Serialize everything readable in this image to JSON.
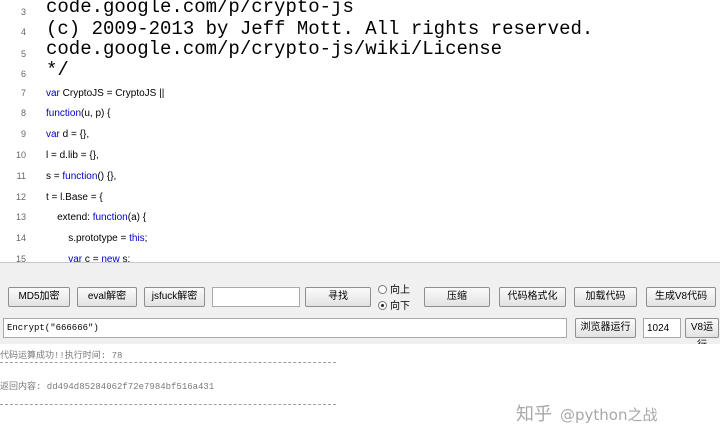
{
  "editor": {
    "lines": [
      {
        "num": "3",
        "text": "code.google.com/p/crypto-js",
        "size": "big",
        "kw": ""
      },
      {
        "num": "4",
        "text": "(c) 2009-2013 by Jeff Mott. All rights reserved.",
        "size": "big",
        "kw": ""
      },
      {
        "num": "5",
        "text": "code.google.com/p/crypto-js/wiki/License",
        "size": "big",
        "kw": ""
      },
      {
        "num": "6",
        "text": "*/",
        "size": "big",
        "kw": ""
      },
      {
        "num": "7",
        "text": " CryptoJS = CryptoJS ||",
        "size": "small",
        "kw": "var"
      },
      {
        "num": "8",
        "text": "(u, p) {",
        "size": "small",
        "kw": "function"
      },
      {
        "num": "9",
        "text": " d = {},",
        "size": "small",
        "kw": "var"
      },
      {
        "num": "10",
        "text": "l = d.lib = {},",
        "size": "small",
        "kw": ""
      },
      {
        "num": "11",
        "text": "s = function() {},",
        "size": "small",
        "kw": ""
      },
      {
        "num": "12",
        "text": "t = l.Base = {",
        "size": "small",
        "kw": ""
      },
      {
        "num": "13",
        "text": "    extend: function(a) {",
        "size": "small",
        "kw": ""
      },
      {
        "num": "14",
        "text": "        s.prototype = this;",
        "size": "small",
        "kw": ""
      },
      {
        "num": "15",
        "text": "        var c = new s;",
        "size": "small",
        "kw": ""
      }
    ]
  },
  "toolbar": {
    "md5_decrypt": "MD5加密",
    "eval_decrypt": "eval解密",
    "jsfuck_decrypt": "jsfuck解密",
    "search_value": "",
    "search_button": "寻找",
    "radio_up": "向上",
    "radio_down": "向下",
    "compress": "压缩",
    "format_code": "代码格式化",
    "load_code": "加载代码",
    "gen_v8": "生成V8代码",
    "command_value": "Encrypt(\"666666\")",
    "browser_run": "浏览器运行",
    "count_value": "1024",
    "v8_run": "V8运行"
  },
  "output": {
    "status": "代码运算成功!!执行时间: 78",
    "result": "返回内容: dd494d85284062f72e7984bf516a431"
  },
  "watermark": {
    "text": "知乎",
    "handle": "@python之战"
  }
}
